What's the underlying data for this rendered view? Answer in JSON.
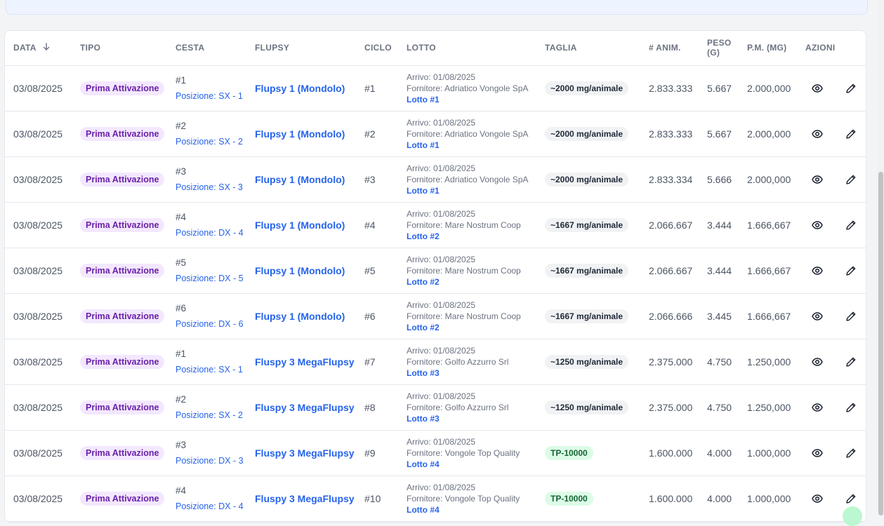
{
  "table": {
    "headers": {
      "data": "DATA",
      "tipo": "TIPO",
      "cesta": "CESTA",
      "flupsy": "FLUPSY",
      "ciclo": "CICLO",
      "lotto": "LOTTO",
      "taglia": "TAGLIA",
      "anim": "# ANIM.",
      "peso_line1": "PESO",
      "peso_line2": "(G)",
      "pm": "P.M. (MG)",
      "azioni": "AZIONI"
    },
    "rows": [
      {
        "data": "03/08/2025",
        "tipo": "Prima Attivazione",
        "cesta": "#1",
        "posizione": "Posizione: SX - 1",
        "flupsy": "Flupsy 1 (Mondolo)",
        "ciclo": "#1",
        "arrivo": "Arrivo: 01/08/2025",
        "fornitore": "Fornitore: Adriatico Vongole SpA",
        "lotto": "Lotto #1",
        "taglia": "~2000 mg/animale",
        "anim": "2.833.333",
        "peso": "5.667",
        "pm": "2.000,000"
      },
      {
        "data": "03/08/2025",
        "tipo": "Prima Attivazione",
        "cesta": "#2",
        "posizione": "Posizione: SX - 2",
        "flupsy": "Flupsy 1 (Mondolo)",
        "ciclo": "#2",
        "arrivo": "Arrivo: 01/08/2025",
        "fornitore": "Fornitore: Adriatico Vongole SpA",
        "lotto": "Lotto #1",
        "taglia": "~2000 mg/animale",
        "anim": "2.833.333",
        "peso": "5.667",
        "pm": "2.000,000"
      },
      {
        "data": "03/08/2025",
        "tipo": "Prima Attivazione",
        "cesta": "#3",
        "posizione": "Posizione: SX - 3",
        "flupsy": "Flupsy 1 (Mondolo)",
        "ciclo": "#3",
        "arrivo": "Arrivo: 01/08/2025",
        "fornitore": "Fornitore: Adriatico Vongole SpA",
        "lotto": "Lotto #1",
        "taglia": "~2000 mg/animale",
        "anim": "2.833.334",
        "peso": "5.666",
        "pm": "2.000,000"
      },
      {
        "data": "03/08/2025",
        "tipo": "Prima Attivazione",
        "cesta": "#4",
        "posizione": "Posizione: DX - 4",
        "flupsy": "Flupsy 1 (Mondolo)",
        "ciclo": "#4",
        "arrivo": "Arrivo: 01/08/2025",
        "fornitore": "Fornitore: Mare Nostrum Coop",
        "lotto": "Lotto #2",
        "taglia": "~1667 mg/animale",
        "anim": "2.066.667",
        "peso": "3.444",
        "pm": "1.666,667"
      },
      {
        "data": "03/08/2025",
        "tipo": "Prima Attivazione",
        "cesta": "#5",
        "posizione": "Posizione: DX - 5",
        "flupsy": "Flupsy 1 (Mondolo)",
        "ciclo": "#5",
        "arrivo": "Arrivo: 01/08/2025",
        "fornitore": "Fornitore: Mare Nostrum Coop",
        "lotto": "Lotto #2",
        "taglia": "~1667 mg/animale",
        "anim": "2.066.667",
        "peso": "3.444",
        "pm": "1.666,667"
      },
      {
        "data": "03/08/2025",
        "tipo": "Prima Attivazione",
        "cesta": "#6",
        "posizione": "Posizione: DX - 6",
        "flupsy": "Flupsy 1 (Mondolo)",
        "ciclo": "#6",
        "arrivo": "Arrivo: 01/08/2025",
        "fornitore": "Fornitore: Mare Nostrum Coop",
        "lotto": "Lotto #2",
        "taglia": "~1667 mg/animale",
        "anim": "2.066.666",
        "peso": "3.445",
        "pm": "1.666,667"
      },
      {
        "data": "03/08/2025",
        "tipo": "Prima Attivazione",
        "cesta": "#1",
        "posizione": "Posizione: SX - 1",
        "flupsy": "Fluspy 3 MegaFlupsy",
        "ciclo": "#7",
        "arrivo": "Arrivo: 01/08/2025",
        "fornitore": "Fornitore: Golfo Azzurro Srl",
        "lotto": "Lotto #3",
        "taglia": "~1250 mg/animale",
        "anim": "2.375.000",
        "peso": "4.750",
        "pm": "1.250,000"
      },
      {
        "data": "03/08/2025",
        "tipo": "Prima Attivazione",
        "cesta": "#2",
        "posizione": "Posizione: SX - 2",
        "flupsy": "Fluspy 3 MegaFlupsy",
        "ciclo": "#8",
        "arrivo": "Arrivo: 01/08/2025",
        "fornitore": "Fornitore: Golfo Azzurro Srl",
        "lotto": "Lotto #3",
        "taglia": "~1250 mg/animale",
        "anim": "2.375.000",
        "peso": "4.750",
        "pm": "1.250,000"
      },
      {
        "data": "03/08/2025",
        "tipo": "Prima Attivazione",
        "cesta": "#3",
        "posizione": "Posizione: DX - 3",
        "flupsy": "Fluspy 3 MegaFlupsy",
        "ciclo": "#9",
        "arrivo": "Arrivo: 01/08/2025",
        "fornitore": "Fornitore: Vongole Top Quality",
        "lotto": "Lotto #4",
        "taglia": "TP-10000",
        "anim": "1.600.000",
        "peso": "4.000",
        "pm": "1.000,000"
      },
      {
        "data": "03/08/2025",
        "tipo": "Prima Attivazione",
        "cesta": "#4",
        "posizione": "Posizione: DX - 4",
        "flupsy": "Fluspy 3 MegaFlupsy",
        "ciclo": "#10",
        "arrivo": "Arrivo: 01/08/2025",
        "fornitore": "Fornitore: Vongole Top Quality",
        "lotto": "Lotto #4",
        "taglia": "TP-10000",
        "anim": "1.600.000",
        "peso": "4.000",
        "pm": "1.000,000"
      }
    ]
  },
  "icons": {
    "sort": "arrow-down-icon",
    "view": "eye-icon",
    "edit": "pencil-icon"
  },
  "colors": {
    "tipo_badge_bg": "#f3e8ff",
    "tipo_badge_text": "#6b21a8",
    "link": "#2563eb",
    "tp_badge_bg": "#dcfce7"
  }
}
